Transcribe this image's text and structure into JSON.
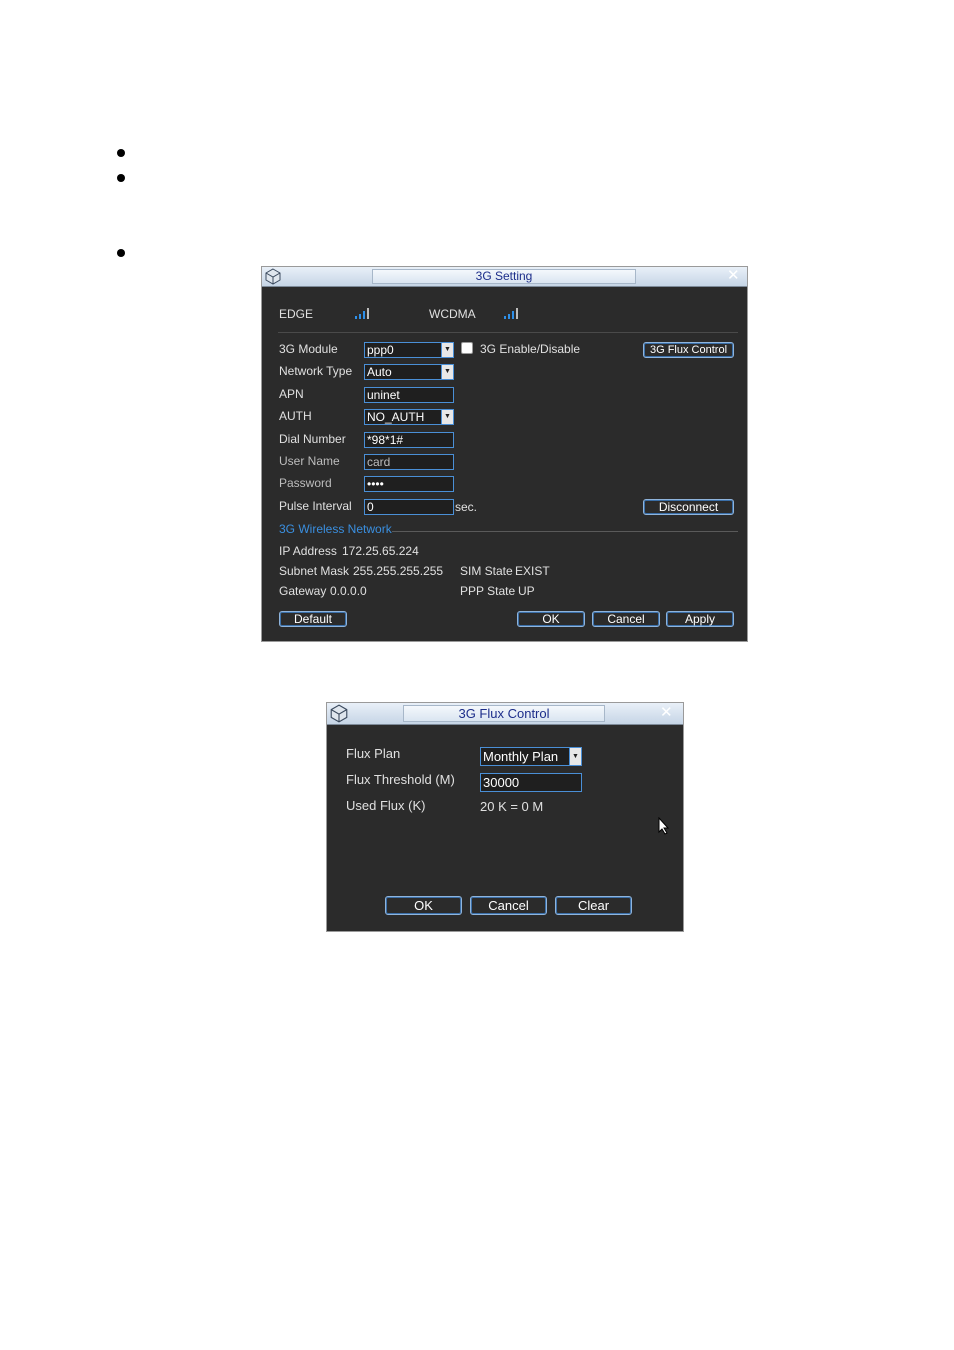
{
  "setting_dialog": {
    "title": "3G Setting",
    "edge_label": "EDGE",
    "wcdma_label": "WCDMA",
    "module_label": "3G  Module",
    "module_value": "ppp0",
    "enable_label": "3G Enable/Disable",
    "flux_control_button": "3G Flux Control",
    "network_type_label": "Network Type",
    "network_type_value": "Auto",
    "apn_label": "APN",
    "apn_value": "uninet",
    "auth_label": "AUTH",
    "auth_value": "NO_AUTH",
    "dial_number_label": "Dial Number",
    "dial_number_value": "*98*1#",
    "user_name_label": "User Name",
    "user_name_value": "card",
    "password_label": "Password",
    "password_value": "••••",
    "pulse_interval_label": "Pulse Interval",
    "pulse_interval_value": "0",
    "pulse_unit": "sec.",
    "disconnect_button": "Disconnect",
    "wireless_section": "3G Wireless Network",
    "ip_address_label": "IP Address",
    "ip_address_value": "172.25.65.224",
    "subnet_mask_label": "Subnet Mask",
    "subnet_mask_value": "255.255.255.255",
    "gateway_label": "Gateway",
    "gateway_value": "0.0.0.0",
    "sim_state_label": "SIM State",
    "sim_state_value": "EXIST",
    "ppp_state_label": "PPP State",
    "ppp_state_value": "UP",
    "default_button": "Default",
    "ok_button": "OK",
    "cancel_button": "Cancel",
    "apply_button": "Apply"
  },
  "flux_dialog": {
    "title": "3G  Flux  Control",
    "flux_plan_label": "Flux Plan",
    "flux_plan_value": "Monthly Plan",
    "flux_threshold_label": "Flux Threshold (M)",
    "flux_threshold_value": "30000",
    "used_flux_label": "Used Flux (K)",
    "used_flux_value": "20 K = 0 M",
    "ok_button": "OK",
    "cancel_button": "Cancel",
    "clear_button": "Clear"
  },
  "icons": {
    "close": "close-icon",
    "app": "app-icon",
    "signal": "signal-icon",
    "dropdown": "chevron-down-icon",
    "cursor": "cursor-icon"
  },
  "colors": {
    "dialog_bg": "#2b2b2b",
    "accent": "#4a8fd6",
    "title_text": "#1c2d8a",
    "section_label": "#3a8fe0"
  }
}
